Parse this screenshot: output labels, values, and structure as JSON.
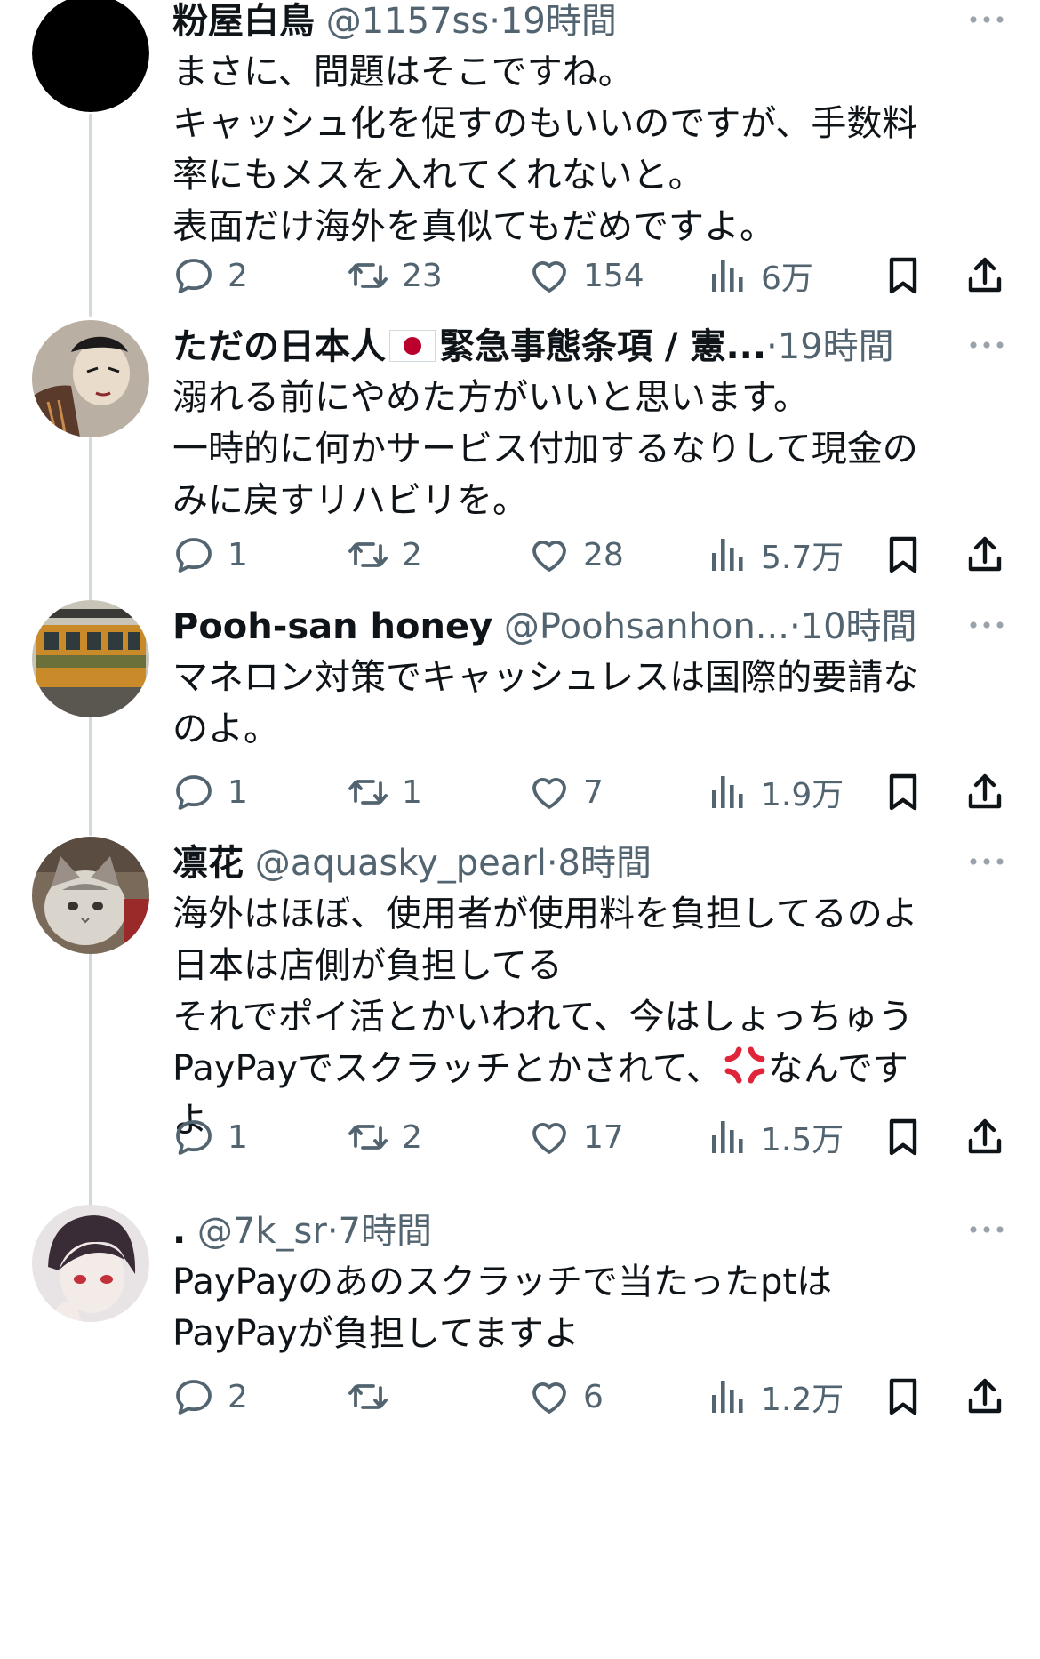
{
  "tweets": [
    {
      "name": "粉屋白鳥",
      "handle": "@1157ss",
      "separator": "·",
      "time": "19時間",
      "flag": false,
      "text_lines": [
        "まさに、問題はそこですね。",
        "キャッシュ化を促すのもいいのですが、手数料",
        "率にもメスを入れてくれないと。",
        "表面だけ海外を真似てもだめですよ。"
      ],
      "stats": {
        "replies": "2",
        "reposts": "23",
        "likes": "154",
        "views": "6万"
      }
    },
    {
      "name": "ただの日本人",
      "name_suffix": "緊急事態条項 / 憲...",
      "handle": "",
      "separator": "·",
      "time": "19時間",
      "flag": true,
      "text_lines": [
        "溺れる前にやめた方がいいと思います。",
        "一時的に何かサービス付加するなりして現金の",
        "みに戻すリハビリを。"
      ],
      "stats": {
        "replies": "1",
        "reposts": "2",
        "likes": "28",
        "views": "5.7万"
      }
    },
    {
      "name": "Pooh-san honey",
      "handle": "@Poohsanhon...",
      "separator": "·",
      "time": "10時間",
      "flag": false,
      "text_lines": [
        "マネロン対策でキャッシュレスは国際的要請な",
        "のよ。"
      ],
      "stats": {
        "replies": "1",
        "reposts": "1",
        "likes": "7",
        "views": "1.9万"
      }
    },
    {
      "name": "凛花",
      "handle": "@aquasky_pearl",
      "separator": "·",
      "time": "8時間",
      "flag": false,
      "text_lines": [
        "海外はほぼ、使用者が使用料を負担してるのよ",
        "日本は店側が負担してる",
        "それでポイ活とかいわれて、今はしょっちゅう"
      ],
      "text_line_4a": "PayPayでスクラッチとかされて、",
      "text_line_4b": "なんです",
      "text_line_5": "よ",
      "stats": {
        "replies": "1",
        "reposts": "2",
        "likes": "17",
        "views": "1.5万"
      }
    },
    {
      "name": ".",
      "handle": "@7k_sr",
      "separator": "·",
      "time": "7時間",
      "flag": false,
      "text_lines": [
        "PayPayのあのスクラッチで当たったptは",
        "PayPayが負担してますよ"
      ],
      "stats": {
        "replies": "2",
        "reposts": "",
        "likes": "6",
        "views": "1.2万"
      }
    }
  ],
  "colors": {
    "text": "#0f1419",
    "secondary": "#536471",
    "thread_line": "#cfd9de",
    "anger_emoji": "#e0243a"
  },
  "icons": [
    "reply-icon",
    "repost-icon",
    "like-icon",
    "views-icon",
    "bookmark-icon",
    "share-icon",
    "more-icon",
    "anger-emoji-icon"
  ]
}
